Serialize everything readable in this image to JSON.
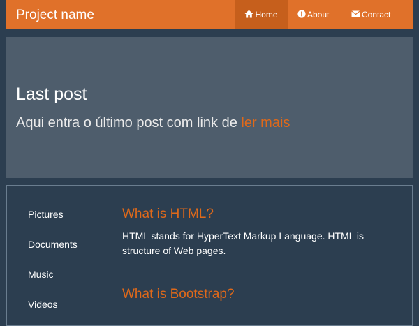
{
  "navbar": {
    "brand": "Project name",
    "items": [
      {
        "label": "Home",
        "icon": "home-icon",
        "active": true
      },
      {
        "label": "About",
        "icon": "info-icon",
        "active": false
      },
      {
        "label": "Contact",
        "icon": "envelope-icon",
        "active": false
      }
    ]
  },
  "jumbotron": {
    "title": "Last post",
    "text": "Aqui entra o último post com link de",
    "link_label": "ler mais"
  },
  "sidebar": {
    "items": [
      "Pictures",
      "Documents",
      "Music",
      "Videos"
    ]
  },
  "main": {
    "sections": [
      {
        "heading": "What is HTML?",
        "body": "HTML stands for HyperText Markup Language. HTML is structure of Web pages."
      },
      {
        "heading": "What is Bootstrap?",
        "body": ""
      }
    ]
  },
  "colors": {
    "navbar_bg": "#e0712a",
    "navbar_active": "#c65f1c",
    "page_bg": "#2c3e50",
    "jumbotron_bg": "#4e5d6c",
    "accent": "#df691a"
  }
}
